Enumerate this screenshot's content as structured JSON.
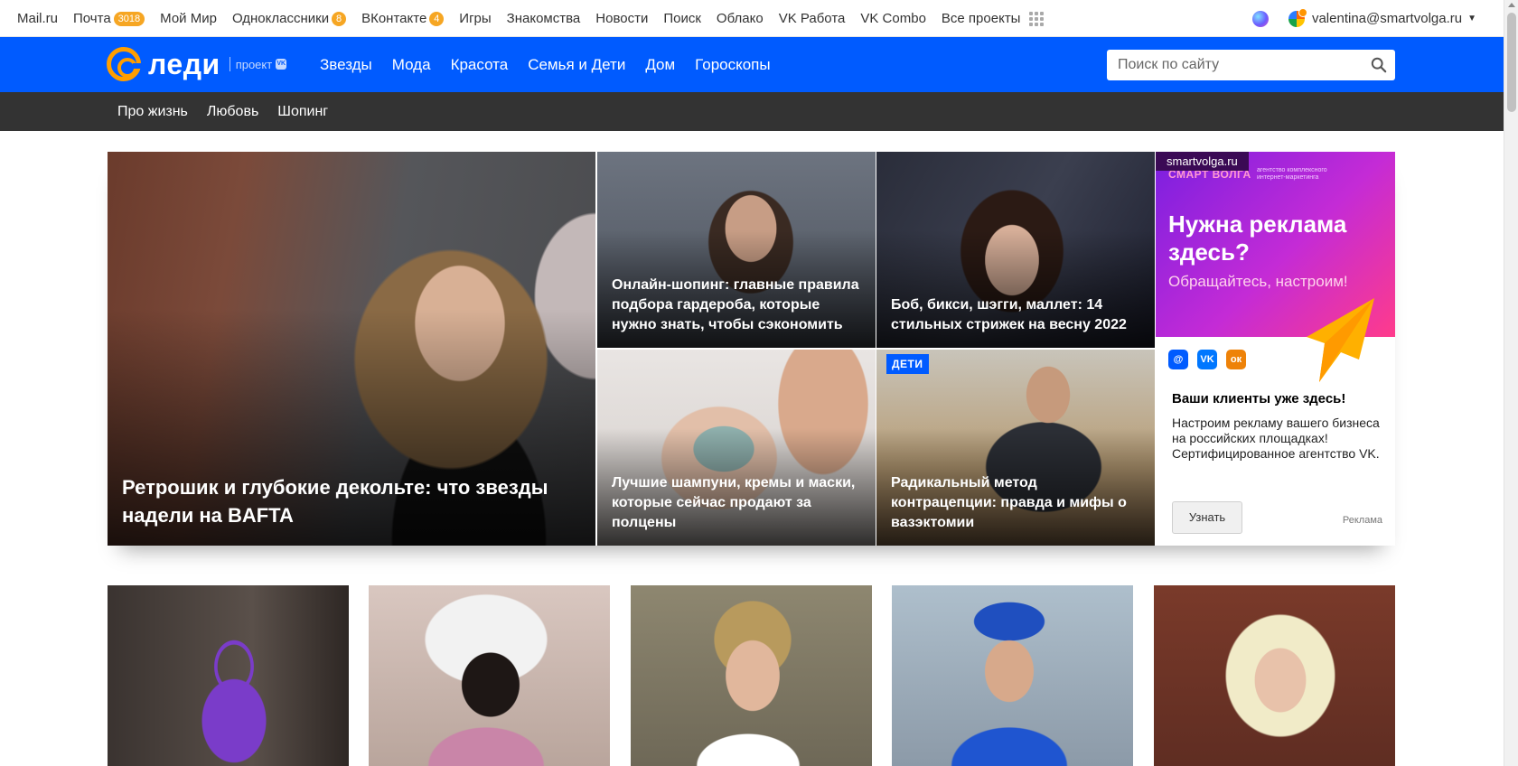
{
  "portal": {
    "links": [
      {
        "label": "Mail.ru"
      },
      {
        "label": "Почта",
        "badge": "3018"
      },
      {
        "label": "Мой Мир"
      },
      {
        "label": "Одноклассники",
        "badge": "8"
      },
      {
        "label": "ВКонтакте",
        "badge": "4"
      },
      {
        "label": "Игры"
      },
      {
        "label": "Знакомства"
      },
      {
        "label": "Новости"
      },
      {
        "label": "Поиск"
      },
      {
        "label": "Облако"
      },
      {
        "label": "VK Работа"
      },
      {
        "label": "VK Combo"
      },
      {
        "label": "Все проекты"
      }
    ],
    "user_email": "valentina@smartvolga.ru",
    "icons": [
      "grid-icon",
      "marusia-orb-icon",
      "user-avatar-icon",
      "caret-down-icon"
    ]
  },
  "header": {
    "logo_text": "леди",
    "logo_project": "проект",
    "logo_vk": "VK",
    "nav": [
      "Звезды",
      "Мода",
      "Красота",
      "Семья и Дети",
      "Дом",
      "Гороскопы"
    ],
    "search_placeholder": "Поиск по сайту",
    "brand_color": "#005bff",
    "accent_color": "#ff9e00"
  },
  "subnav": {
    "items": [
      "Про жизнь",
      "Любовь",
      "Шопинг"
    ],
    "background": "#333333"
  },
  "hero": {
    "big": {
      "title": "Ретрошик и глубокие декольте: что звезды надели на BAFTA"
    },
    "cards": [
      {
        "title": "Онлайн-шопинг: главные правила подбора гардероба, которые нужно знать, чтобы сэкономить"
      },
      {
        "title": "Боб, бикси, шэгги, маллет: 14 стильных стрижек на весну 2022"
      },
      {
        "title": "Лучшие шампуни, кремы и маски, которые сейчас продают за полцены"
      },
      {
        "title": "Радикальный метод контрацепции: правда и мифы о вазэктомии",
        "tag": "ДЕТИ"
      }
    ]
  },
  "ad": {
    "site": "smartvolga.ru",
    "logo": "СМАРТ ВОЛГА",
    "logo_sub": "агентство комплексного интернет-маркетинга",
    "headline": "Нужна реклама здесь?",
    "subline": "Обращайтесь, настроим!",
    "socials": [
      "@",
      "VK",
      "ок"
    ],
    "title": "Ваши клиенты уже здесь!",
    "text": "Настроим рекламу вашего бизнеса на российских площадках! Сертифицированное агентство VK.",
    "button": "Узнать",
    "label": "Реклама"
  },
  "thumbs": [
    {
      "name": "purple-bag"
    },
    {
      "name": "hair-wash"
    },
    {
      "name": "blonde-woman"
    },
    {
      "name": "woman-blue-hat"
    },
    {
      "name": "platinum-blonde"
    }
  ]
}
